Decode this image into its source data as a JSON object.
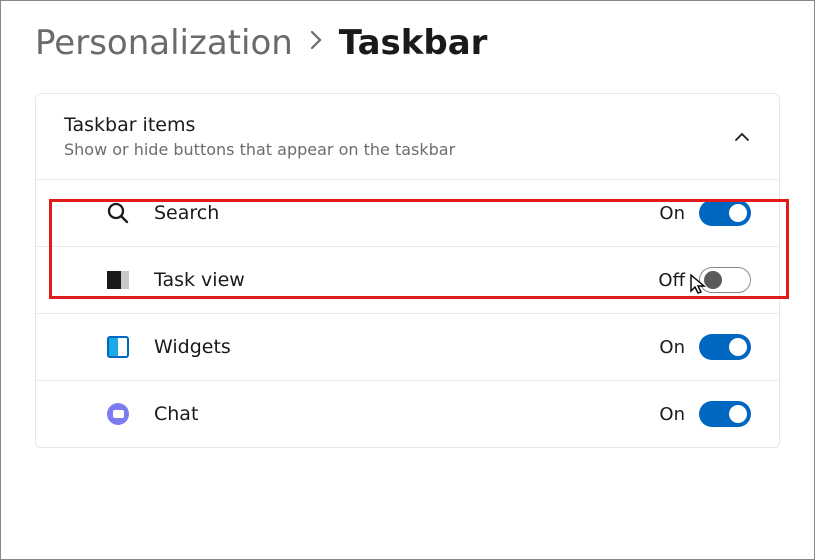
{
  "breadcrumb": {
    "parent": "Personalization",
    "current": "Taskbar"
  },
  "section": {
    "title": "Taskbar items",
    "subtitle": "Show or hide buttons that appear on the taskbar"
  },
  "labels": {
    "on": "On",
    "off": "Off"
  },
  "items": [
    {
      "label": "Search",
      "state": "on"
    },
    {
      "label": "Task view",
      "state": "off"
    },
    {
      "label": "Widgets",
      "state": "on"
    },
    {
      "label": "Chat",
      "state": "on"
    }
  ]
}
